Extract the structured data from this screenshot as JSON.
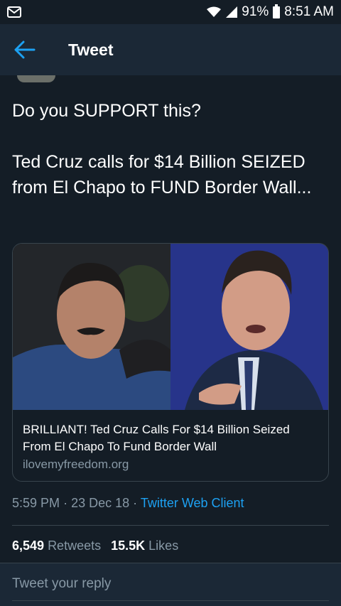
{
  "status_bar": {
    "battery": "91%",
    "time": "8:51 AM"
  },
  "header": {
    "title": "Tweet"
  },
  "tweet": {
    "text": "Do you SUPPORT this?\n\nTed Cruz calls for $14 Billion SEIZED from El Chapo to FUND Border Wall...",
    "card": {
      "title": "BRILLIANT! Ted Cruz Calls For $14 Billion Seized From El Chapo To Fund Border Wall",
      "domain": "ilovemyfreedom.org"
    },
    "time": "5:59 PM",
    "sep1": "·",
    "date": "23 Dec 18",
    "sep2": "·",
    "client": "Twitter Web Client",
    "retweets_count": "6,549",
    "retweets_label": "Retweets",
    "likes_count": "15.5K",
    "likes_label": "Likes"
  },
  "reply": {
    "placeholder": "Tweet your reply"
  },
  "colors": {
    "background": "#141d26",
    "header": "#1b2836",
    "accent": "#1da1f2",
    "muted": "#8899a6"
  }
}
